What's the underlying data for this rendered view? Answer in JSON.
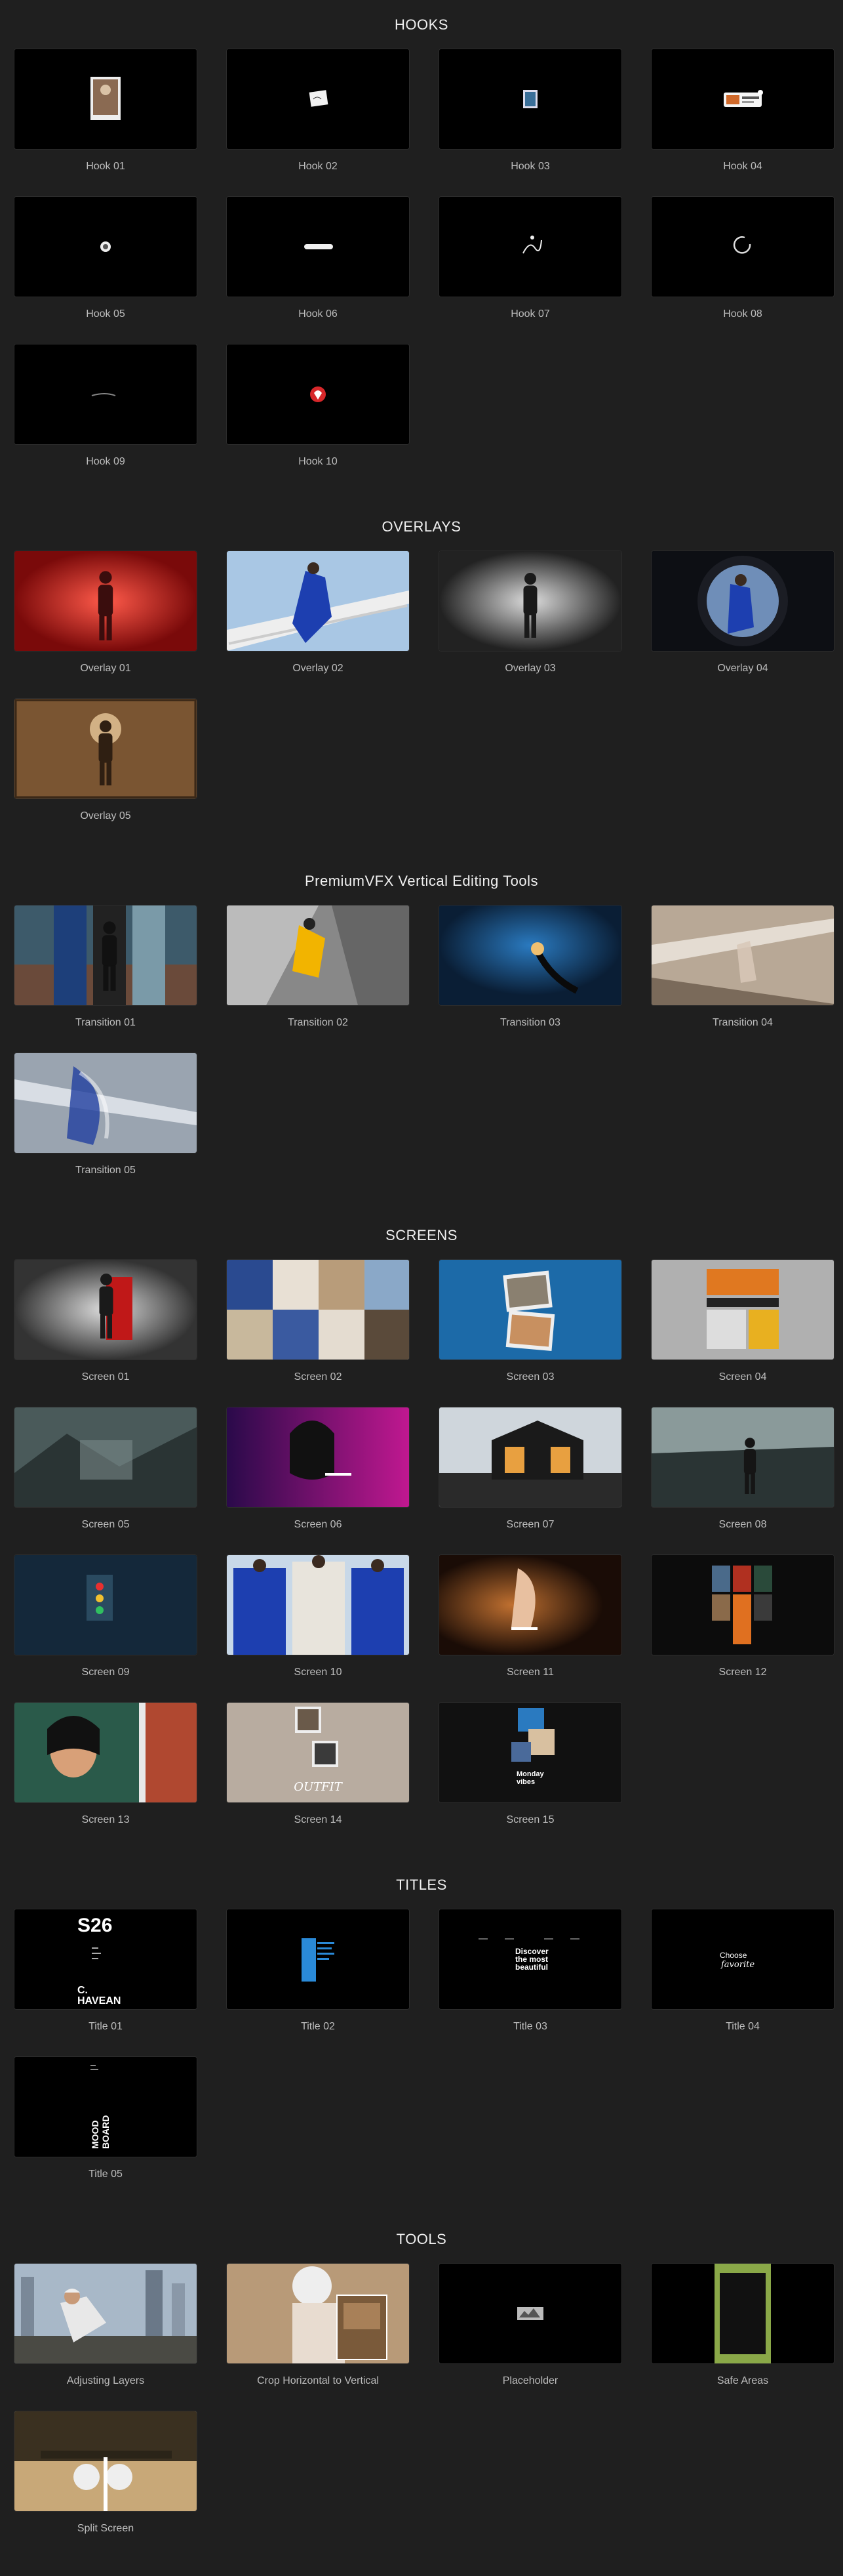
{
  "sections": [
    {
      "title": "HOOKS",
      "items": [
        "Hook 01",
        "Hook 02",
        "Hook 03",
        "Hook 04",
        "Hook 05",
        "Hook 06",
        "Hook 07",
        "Hook 08",
        "Hook 09",
        "Hook 10"
      ]
    },
    {
      "title": "OVERLAYS",
      "items": [
        "Overlay 01",
        "Overlay 02",
        "Overlay 03",
        "Overlay 04",
        "Overlay 05"
      ]
    },
    {
      "title": "PremiumVFX Vertical Editing Tools",
      "items": [
        "Transition 01",
        "Transition 02",
        "Transition 03",
        "Transition 04",
        "Transition 05"
      ]
    },
    {
      "title": "SCREENS",
      "items": [
        "Screen 01",
        "Screen 02",
        "Screen 03",
        "Screen 04",
        "Screen 05",
        "Screen 06",
        "Screen 07",
        "Screen 08",
        "Screen 09",
        "Screen 10",
        "Screen 11",
        "Screen 12",
        "Screen 13",
        "Screen 14",
        "Screen 15"
      ]
    },
    {
      "title": "TITLES",
      "items": [
        "Title 01",
        "Title 02",
        "Title 03",
        "Title 04",
        "Title 05"
      ]
    },
    {
      "title": "TOOLS",
      "items": [
        "Adjusting Layers",
        "Crop Horizontal to Vertical",
        "Placeholder",
        "Safe Areas",
        "Split Screen"
      ]
    }
  ],
  "thumb_text": {
    "title01_big": "S26",
    "title01_name": "C.\nHAVEAN",
    "title03": "Discover\nthe most\nbeautiful",
    "title04_a": "Choose",
    "title04_b": "favorite",
    "title05": "MOOD\nBOARD",
    "screen14": "OUTFIT",
    "screen15": "Monday\nvibes"
  },
  "colors": {
    "background": "#1f1f1f",
    "thumb_bg": "#000000",
    "caption": "#bdbdbd",
    "heading": "#f0f0f0"
  }
}
